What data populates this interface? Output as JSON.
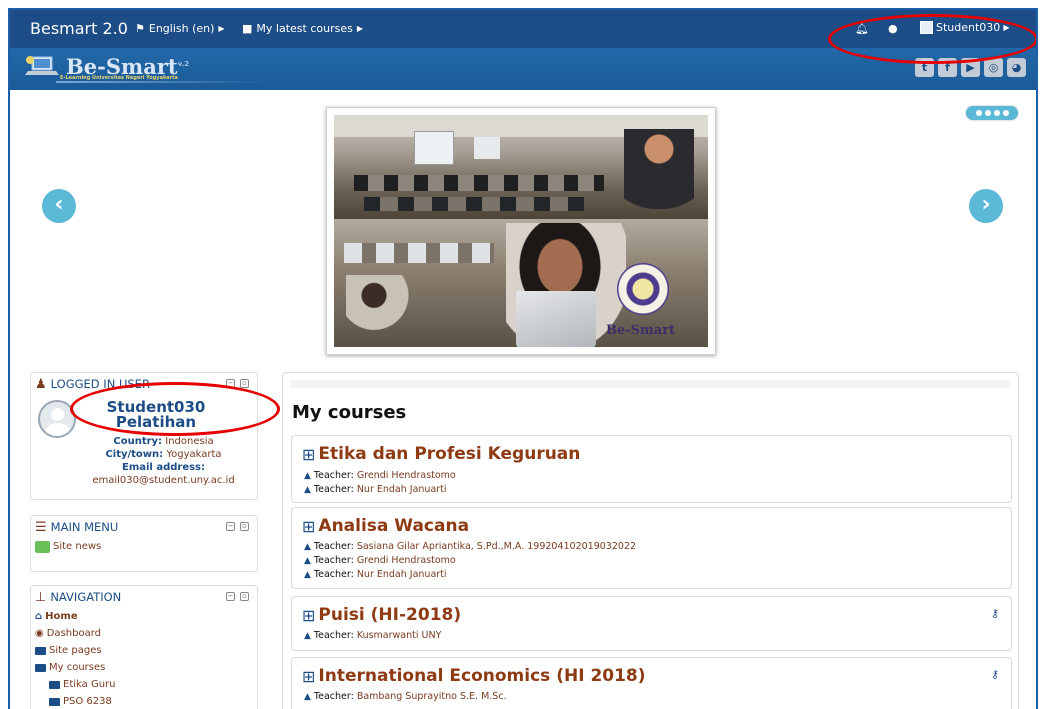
{
  "navbar": {
    "brand": "Besmart 2.0",
    "language": "English (en)",
    "my_courses": "My latest courses",
    "user": "Student030"
  },
  "header": {
    "logo_title": "Be-Smart",
    "logo_version": "v.2",
    "logo_subtitle": "E-Learning Universitas Negeri Yogyakarta",
    "social": [
      "twitter-icon",
      "facebook-icon",
      "youtube-icon",
      "instagram-icon",
      "web-icon"
    ]
  },
  "slider": {
    "caption": "Be-Smart",
    "dots": 4
  },
  "logged_in": {
    "title": "LOGGED IN USER",
    "name": "Student030 Pelatihan",
    "country_label": "Country:",
    "country": "Indonesia",
    "city_label": "City/town:",
    "city": "Yogyakarta",
    "email_label": "Email address:",
    "email": "email030@student.uny.ac.id"
  },
  "main_menu": {
    "title": "MAIN MENU",
    "items": [
      "Site news"
    ]
  },
  "navigation": {
    "title": "NAVIGATION",
    "home": "Home",
    "dashboard": "Dashboard",
    "site_pages": "Site pages",
    "my_courses": "My courses",
    "courses": [
      "Etika Guru",
      "PSO 6238"
    ]
  },
  "main": {
    "heading": "My courses",
    "teacher_label": "Teacher:",
    "courses": [
      {
        "title": "Etika dan Profesi Keguruan",
        "teachers": [
          "Grendi Hendrastomo",
          "Nur Endah Januarti"
        ]
      },
      {
        "title": "Analisa Wacana",
        "teachers": [
          "Sasiana Gilar Apriantika, S.Pd.,M.A. 199204102019032022",
          "Grendi Hendrastomo",
          "Nur Endah Januarti"
        ]
      },
      {
        "title": "Puisi (HI-2018)",
        "teachers": [
          "Kusmarwanti UNY"
        ]
      },
      {
        "title": "International Economics (HI 2018)",
        "teachers": [
          "Bambang Suprayitno S.E. M.Sc."
        ]
      }
    ]
  },
  "colors": {
    "navbar": "#1c4d86",
    "course_title": "#8e3b14",
    "accent": "#5bb8d6",
    "annotation": "#e60000"
  }
}
